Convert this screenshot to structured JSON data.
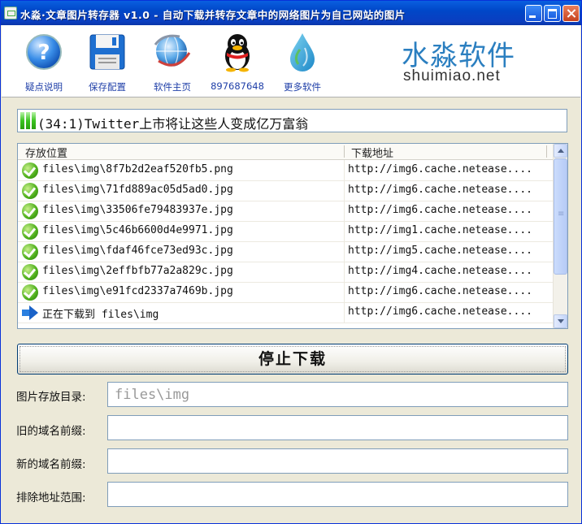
{
  "window": {
    "title": "水淼·文章图片转存器 v1.0 - 自动下载并转存文章中的网络图片为自己网站的图片"
  },
  "toolbar": {
    "items": [
      {
        "label": "疑点说明",
        "icon": "help-icon"
      },
      {
        "label": "保存配置",
        "icon": "floppy-save-icon"
      },
      {
        "label": "软件主页",
        "icon": "globe-icon"
      },
      {
        "label": "897687648",
        "icon": "qq-penguin-icon"
      },
      {
        "label": "更多软件",
        "icon": "water-drop-icon"
      }
    ],
    "brand_cn": "水淼软件",
    "brand_en": "shuimiao.net"
  },
  "progress": {
    "text": "(34:1)Twitter上市将让这些人变成亿万富翁"
  },
  "list": {
    "columns": [
      "存放位置",
      "下载地址"
    ],
    "rows": [
      {
        "status": "done",
        "path": "files\\img\\8f7b2d2eaf520fb5.png",
        "url": "http://img6.cache.netease...."
      },
      {
        "status": "done",
        "path": "files\\img\\71fd889ac05d5ad0.jpg",
        "url": "http://img6.cache.netease...."
      },
      {
        "status": "done",
        "path": "files\\img\\33506fe79483937e.jpg",
        "url": "http://img6.cache.netease...."
      },
      {
        "status": "done",
        "path": "files\\img\\5c46b6600d4e9971.jpg",
        "url": "http://img1.cache.netease...."
      },
      {
        "status": "done",
        "path": "files\\img\\fdaf46fce73ed93c.jpg",
        "url": "http://img5.cache.netease...."
      },
      {
        "status": "done",
        "path": "files\\img\\2effbfb77a2a829c.jpg",
        "url": "http://img4.cache.netease...."
      },
      {
        "status": "done",
        "path": "files\\img\\e91fcd2337a7469b.jpg",
        "url": "http://img6.cache.netease...."
      },
      {
        "status": "downloading",
        "path": "正在下载到 files\\img",
        "url": "http://img6.cache.netease...."
      }
    ]
  },
  "stop_button": {
    "label": "停止下载"
  },
  "form": {
    "image_dir": {
      "label": "图片存放目录:",
      "value": "",
      "placeholder": "files\\img"
    },
    "old_domain": {
      "label": "旧的域名前缀:",
      "value": ""
    },
    "new_domain": {
      "label": "新的域名前缀:",
      "value": ""
    },
    "exclude_range": {
      "label": "排除地址范围:",
      "value": ""
    }
  },
  "colors": {
    "title_bar": "#0a4ed0",
    "link_blue": "#1f3fa8",
    "brand_blue": "#2b7fc0",
    "progress_green": "#3bc420"
  }
}
